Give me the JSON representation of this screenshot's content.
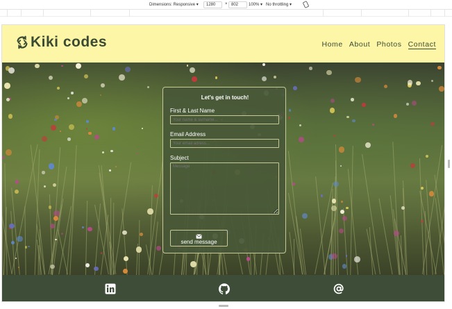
{
  "devtools": {
    "dimensions_label": "Dimensions: Responsive",
    "width": "1280",
    "times": "×",
    "height": "802",
    "zoom": "100%",
    "throttling": "No throttling"
  },
  "site": {
    "brand": "Kiki codes",
    "nav": [
      "Home",
      "About",
      "Photos",
      "Contact"
    ],
    "active_nav": "Contact"
  },
  "form": {
    "title": "Let's get in touch!",
    "name_label": "First & Last Name",
    "name_placeholder": "Your name & surname...",
    "email_label": "Email Address",
    "email_placeholder": "Your email adress...",
    "subject_label": "Subject",
    "subject_placeholder": "Message",
    "send_label": "send message"
  },
  "footer": {
    "icons": [
      "linkedin-icon",
      "github-icon",
      "at-sign-icon"
    ]
  },
  "colors": {
    "header_bg": "#fcf6a6",
    "brand_text": "#3b4a33",
    "footer_bg": "#3d4d37",
    "card_bg": "#485838",
    "card_border": "#c8c996"
  }
}
